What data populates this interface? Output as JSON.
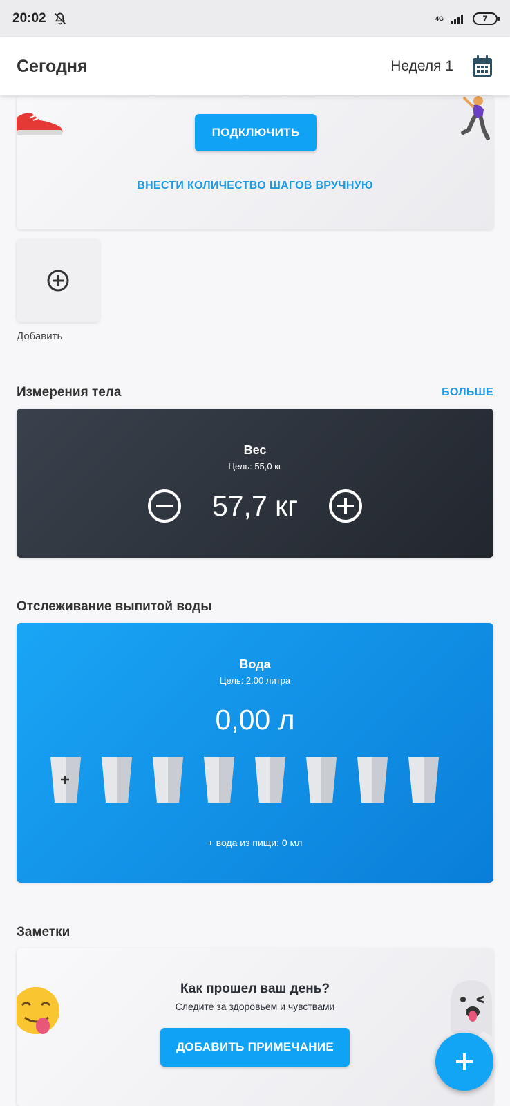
{
  "status_bar": {
    "time": "20:02",
    "network": "4G",
    "battery": "7"
  },
  "app_bar": {
    "title": "Сегодня",
    "week": "Неделя 1"
  },
  "steps_card": {
    "connect_button": "ПОДКЛЮЧИТЬ",
    "manual_link": "ВНЕСТИ КОЛИЧЕСТВО ШАГОВ ВРУЧНУЮ"
  },
  "add_tile": {
    "label": "Добавить"
  },
  "body_measurements": {
    "section_title": "Измерения тела",
    "more_link": "БОЛЬШЕ",
    "title": "Вес",
    "goal": "Цель: 55,0 кг",
    "value": "57,7 кг"
  },
  "water": {
    "section_title": "Отслеживание выпитой воды",
    "title": "Вода",
    "goal": "Цель: 2.00 литра",
    "value": "0,00 л",
    "glasses_total": 8,
    "glasses_filled": 0,
    "food_water": "+ вода из пищи: 0 мл"
  },
  "notes": {
    "section_title": "Заметки",
    "question": "Как прошел ваш день?",
    "subtitle": "Следите за здоровьем и чувствами",
    "add_button": "ДОБАВИТЬ ПРИМЕЧАНИЕ"
  },
  "colors": {
    "accent": "#10a2f5",
    "weight_card": "#2e343c",
    "water_card": "#0a8fe6"
  }
}
